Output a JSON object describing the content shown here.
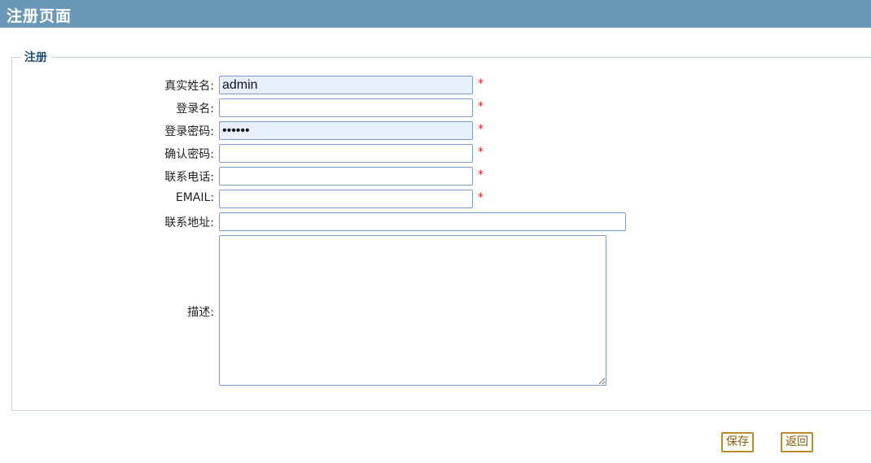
{
  "header": {
    "title": "注册页面"
  },
  "form": {
    "legend": "注册",
    "required_mark": "*",
    "fields": {
      "real_name": {
        "label": "真实姓名:",
        "value": "admin"
      },
      "login_name": {
        "label": "登录名:",
        "value": ""
      },
      "password": {
        "label": "登录密码:",
        "value": "123456"
      },
      "confirm_password": {
        "label": "确认密码:",
        "value": ""
      },
      "phone": {
        "label": "联系电话:",
        "value": ""
      },
      "email": {
        "label": "EMAIL:",
        "value": ""
      },
      "address": {
        "label": "联系地址:",
        "value": ""
      },
      "description": {
        "label": "描述:",
        "value": ""
      }
    }
  },
  "buttons": {
    "save_label": "保存",
    "back_label": "返回"
  },
  "colors": {
    "header_bg": "#6a98b6",
    "legend_text": "#1e4f78",
    "required_star": "#e02020",
    "button_border": "#b98c2e",
    "autofill_bg": "#e8f0fe"
  }
}
